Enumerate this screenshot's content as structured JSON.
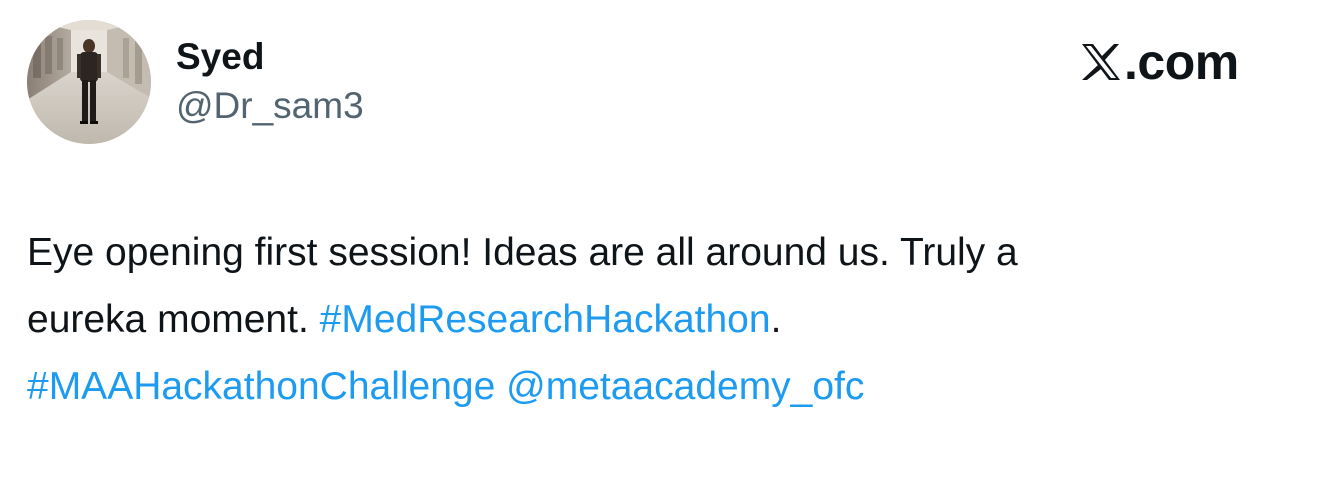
{
  "author": {
    "display_name": "Syed",
    "handle": "@Dr_sam3"
  },
  "brand": {
    "icon": "x-logo-icon",
    "label": ".com"
  },
  "tweet": {
    "line1": "Eye opening first session! Ideas are all around us. Truly a",
    "line2_text": "eureka moment. ",
    "hashtag1": "#MedResearchHackathon",
    "line2_punct": ".",
    "hashtag2": "#MAAHackathonChallenge",
    "mention": "@metaacademy_ofc"
  },
  "colors": {
    "text": "#0f1419",
    "secondary": "#536471",
    "link": "#1d9bf0",
    "background": "#ffffff"
  }
}
